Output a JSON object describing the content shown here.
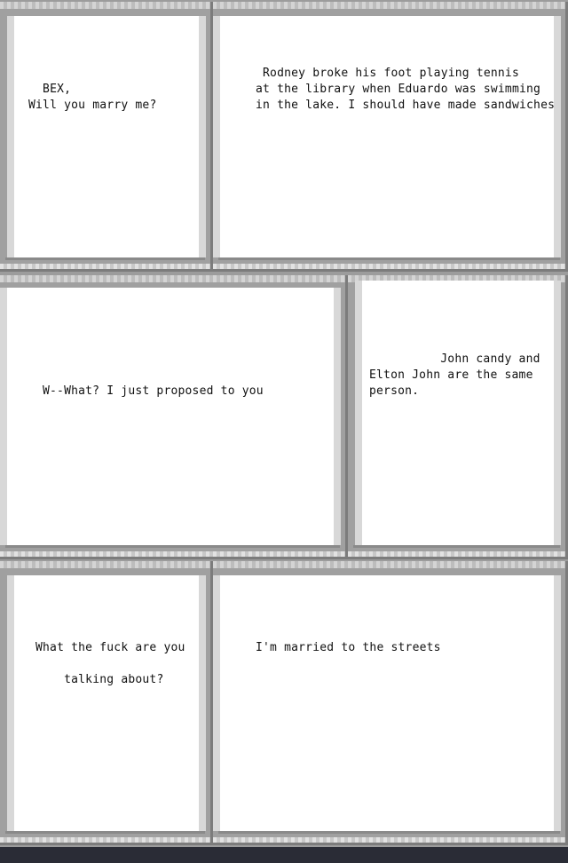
{
  "panels": [
    {
      "text": "  BEX,\nWill you marry me?"
    },
    {
      "text": " Rodney broke his foot playing tennis\nat the library when Eduardo was swimming\nin the lake. I should have made sandwiches"
    },
    {
      "text": "W--What? I just proposed to you"
    },
    {
      "text": "          John candy and\nElton John are the same\nperson."
    },
    {
      "text": "What the fuck are you\n    talking about?"
    },
    {
      "text": "I'm married to the streets"
    }
  ]
}
